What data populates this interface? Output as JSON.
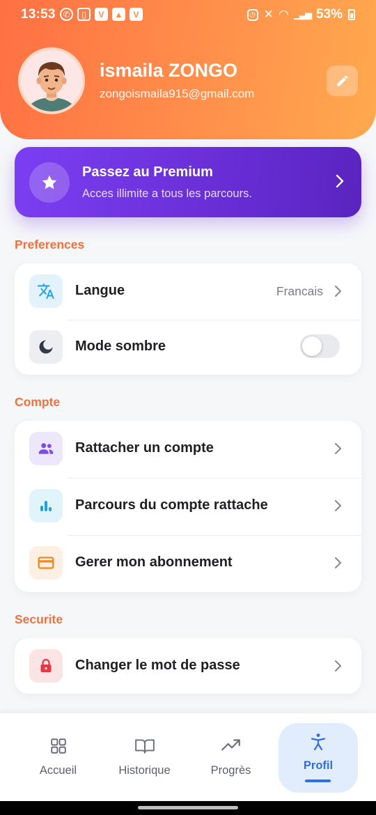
{
  "status_bar": {
    "time": "13:53",
    "battery": "53%"
  },
  "profile": {
    "name": "ismaila ZONGO",
    "email": "zongoismaila915@gmail.com"
  },
  "premium": {
    "title": "Passez au Premium",
    "subtitle": "Acces illimite a tous les parcours."
  },
  "sections": {
    "preferences": {
      "title": "Preferences",
      "language": {
        "label": "Langue",
        "value": "Francais",
        "icon": "translate-icon"
      },
      "dark_mode": {
        "label": "Mode sombre",
        "icon": "moon-icon",
        "enabled": false
      }
    },
    "account": {
      "title": "Compte",
      "link_account": {
        "label": "Rattacher un compte",
        "icon": "people-icon"
      },
      "linked_progress": {
        "label": "Parcours du compte rattache",
        "icon": "bar-chart-icon"
      },
      "subscription": {
        "label": "Gerer mon abonnement",
        "icon": "credit-card-icon"
      }
    },
    "security": {
      "title": "Securite",
      "change_password": {
        "label": "Changer le mot de passe",
        "icon": "lock-icon"
      }
    }
  },
  "bottom_nav": {
    "home": "Accueil",
    "history": "Historique",
    "progress": "Progrès",
    "profile": "Profil",
    "active": "profile"
  },
  "colors": {
    "header_gradient_start": "#ff7043",
    "header_gradient_end": "#ffa94f",
    "premium": "#6a2fd8",
    "section_title": "#f0703f",
    "nav_active": "#2f6fe0"
  }
}
